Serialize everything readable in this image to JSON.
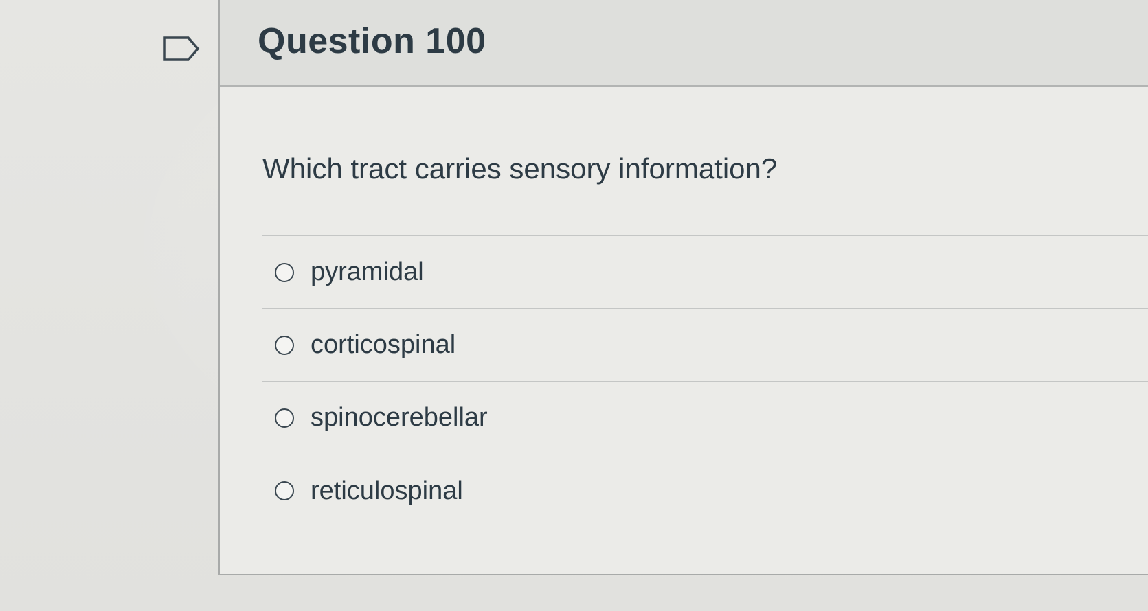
{
  "question": {
    "title": "Question 100",
    "text": "Which tract carries sensory information?"
  },
  "answers": [
    {
      "label": "pyramidal"
    },
    {
      "label": "corticospinal"
    },
    {
      "label": "spinocerebellar"
    },
    {
      "label": "reticulospinal"
    }
  ],
  "icons": {
    "flag": "flag-outline-icon",
    "radio": "radio-unselected-icon"
  },
  "colors": {
    "text": "#2d3b45",
    "header_bg": "#dedfdc",
    "border": "#a8aaa9"
  }
}
